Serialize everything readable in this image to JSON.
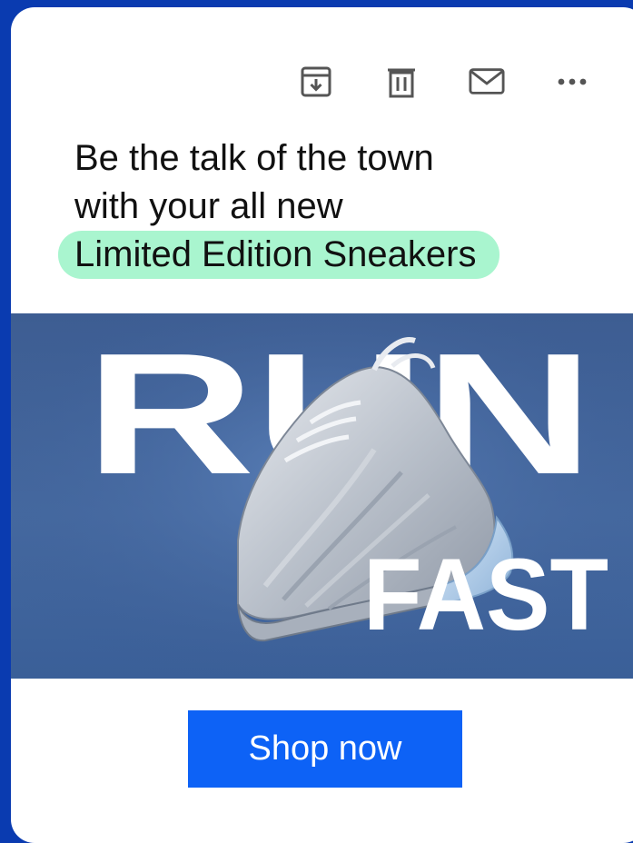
{
  "toolbar": {
    "icons": [
      "archive-icon",
      "trash-icon",
      "mail-icon",
      "more-icon"
    ]
  },
  "headline": {
    "line1": "Be the talk of the town",
    "line2": "with your all new",
    "highlight": "Limited Edition Sneakers"
  },
  "hero": {
    "word_top": "RUN",
    "word_bottom": "FAST"
  },
  "cta": {
    "label": "Shop now"
  },
  "colors": {
    "frame": "#0a3bb0",
    "highlight": "#a9f5cf",
    "cta": "#0d62f6",
    "hero_bg": "#4569a0"
  }
}
